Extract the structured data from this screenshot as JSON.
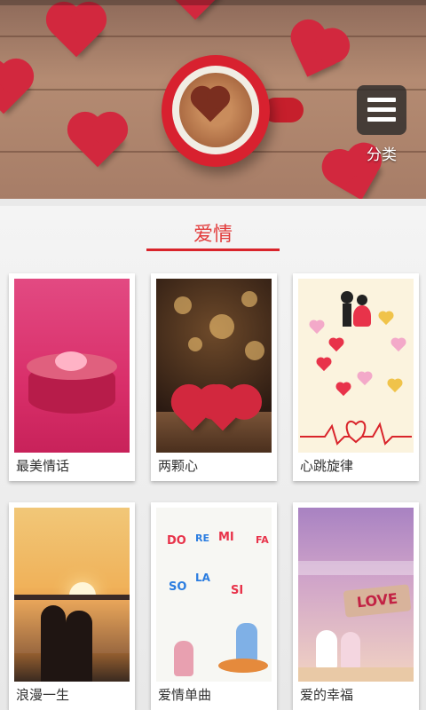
{
  "banner": {
    "category_label": "分类"
  },
  "section": {
    "title": "爱情"
  },
  "cards": [
    {
      "label": "最美情话"
    },
    {
      "label": "两颗心"
    },
    {
      "label": "心跳旋律"
    },
    {
      "label": "浪漫一生"
    },
    {
      "label": "爱情单曲"
    },
    {
      "label": "爱的幸福"
    }
  ],
  "card_art_text": {
    "love_sign": "LOVE",
    "music_notes": [
      "DO",
      "RE",
      "MI",
      "FA",
      "SO",
      "LA",
      "SI"
    ]
  },
  "colors": {
    "accent": "#d9242b",
    "title": "#e23b3b"
  }
}
